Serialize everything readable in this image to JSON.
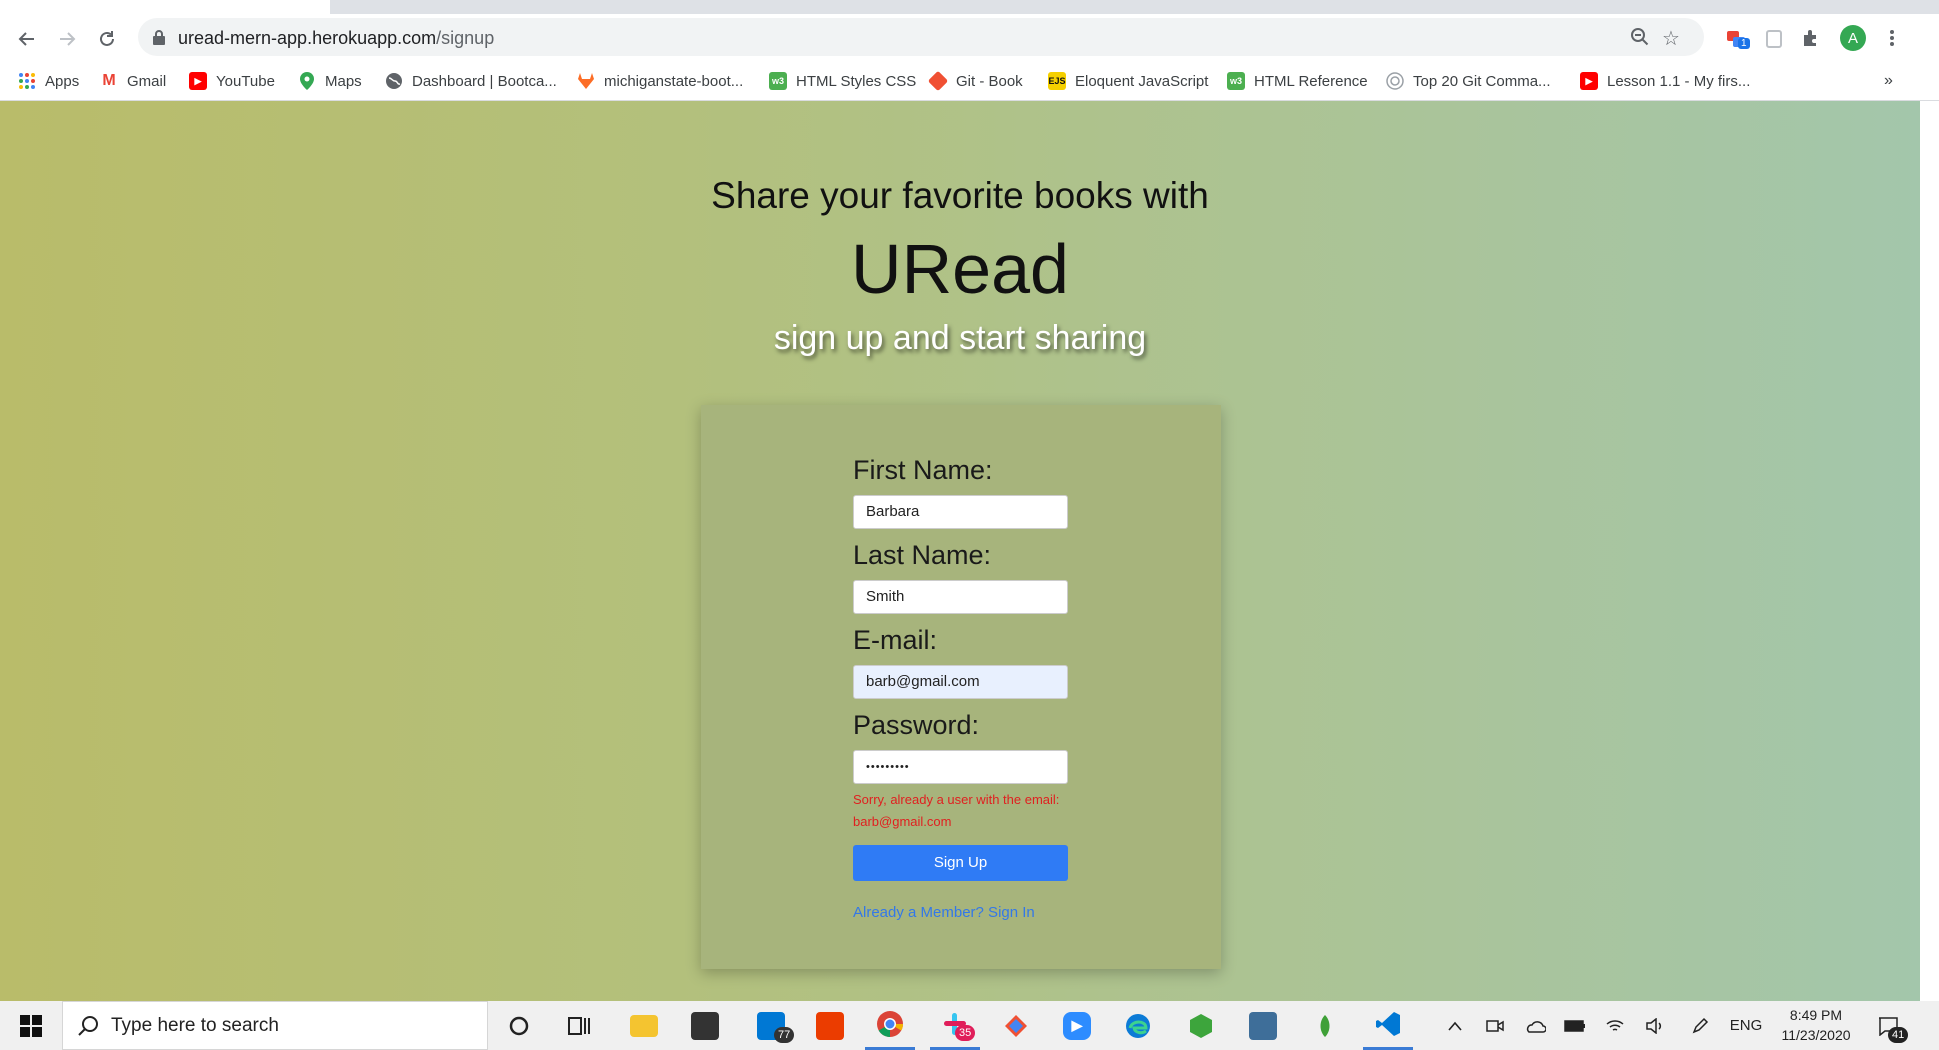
{
  "browser": {
    "url_host": "uread-mern-app.herokuapp.com",
    "url_path": "/signup",
    "profile_initial": "A",
    "extension_badge": "1",
    "more_bookmarks": "»"
  },
  "bookmarks": [
    {
      "label": "Apps",
      "icon": "apps-grid-icon"
    },
    {
      "label": "Gmail",
      "icon": "gmail-icon"
    },
    {
      "label": "YouTube",
      "icon": "youtube-icon"
    },
    {
      "label": "Maps",
      "icon": "maps-icon"
    },
    {
      "label": "Dashboard | Bootca...",
      "icon": "globe-icon"
    },
    {
      "label": "michiganstate-boot...",
      "icon": "gitlab-icon"
    },
    {
      "label": "HTML Styles CSS",
      "icon": "w3schools-icon"
    },
    {
      "label": "Git - Book",
      "icon": "git-icon"
    },
    {
      "label": "Eloquent JavaScript",
      "icon": "ejs-icon"
    },
    {
      "label": "HTML Reference",
      "icon": "w3schools-icon"
    },
    {
      "label": "Top 20 Git Comma...",
      "icon": "site-icon"
    },
    {
      "label": "Lesson 1.1 - My firs...",
      "icon": "youtube-icon"
    }
  ],
  "hero": {
    "line1": "Share your favorite books with",
    "brand": "URead",
    "tagline": "sign up and start sharing"
  },
  "form": {
    "first_name_label": "First Name:",
    "first_name_value": "Barbara",
    "last_name_label": "Last Name:",
    "last_name_value": "Smith",
    "email_label": "E-mail:",
    "email_value": "barb@gmail.com",
    "password_label": "Password:",
    "password_value": "•••••••••",
    "error_message": "Sorry, already a user with the email: barb@gmail.com",
    "submit_label": "Sign Up",
    "signin_link": "Already a Member? Sign In"
  },
  "taskbar": {
    "search_placeholder": "Type here to search",
    "mail_badge": "77",
    "slack_badge": "35",
    "notification_badge": "41",
    "language": "ENG",
    "time": "8:49 PM",
    "date": "11/23/2020"
  },
  "colors": {
    "button": "#2f7bf5",
    "error": "#e02020",
    "link": "#3378e8",
    "card": "#a7b47c"
  }
}
